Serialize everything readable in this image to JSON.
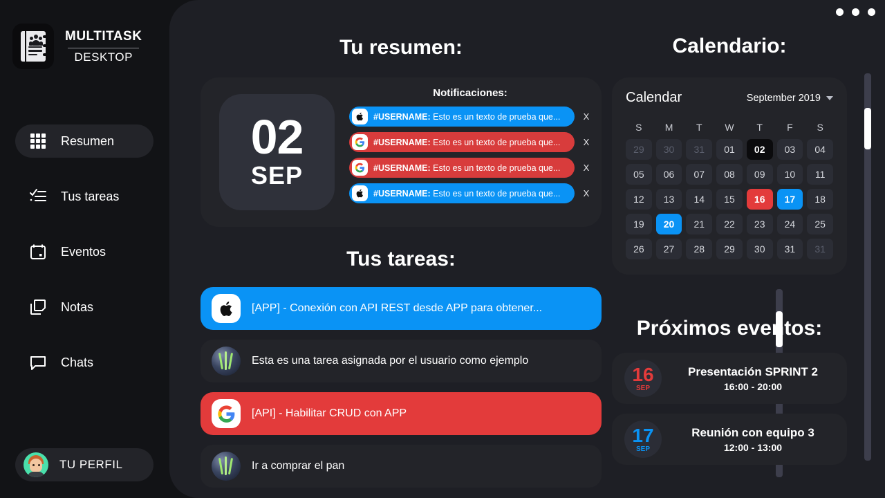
{
  "brand": {
    "title": "MULTITASK",
    "subtitle": "DESKTOP",
    "logo_icon": "contacts-book-icon"
  },
  "sidebar": {
    "items": [
      {
        "label": "Resumen",
        "icon": "grid-icon",
        "active": true
      },
      {
        "label": "Tus tareas",
        "icon": "checklist-icon",
        "active": false
      },
      {
        "label": "Eventos",
        "icon": "calendar-icon",
        "active": false
      },
      {
        "label": "Notas",
        "icon": "notes-icon",
        "active": false
      },
      {
        "label": "Chats",
        "icon": "chat-icon",
        "active": false
      }
    ],
    "profile": {
      "label": "TU PERFIL",
      "avatar_icon": "user-avatar"
    }
  },
  "window": {
    "dots": [
      "window-dot-1",
      "window-dot-2",
      "window-dot-3"
    ]
  },
  "summary": {
    "heading": "Tu resumen:",
    "date": {
      "day": "02",
      "month": "SEP"
    },
    "notifications_title": "Notificaciones:",
    "notifications": [
      {
        "provider": "apple-icon",
        "color": "blue",
        "user": "#USERNAME:",
        "text": "Esto es un texto de prueba que...",
        "close": "X"
      },
      {
        "provider": "google-icon",
        "color": "red",
        "user": "#USERNAME:",
        "text": "Esto es un texto de prueba que...",
        "close": "X"
      },
      {
        "provider": "google-icon",
        "color": "red",
        "user": "#USERNAME:",
        "text": "Esto es un texto de prueba que...",
        "close": "X"
      },
      {
        "provider": "apple-icon",
        "color": "blue",
        "user": "#USERNAME:",
        "text": "Esto es un texto de prueba que...",
        "close": "X"
      }
    ]
  },
  "tasks": {
    "heading": "Tus tareas:",
    "items": [
      {
        "badge": "apple-icon",
        "color": "blue",
        "text": "[APP] - Conexión con API REST desde APP para obtener..."
      },
      {
        "badge": "user-photo",
        "color": "neutral",
        "text": "Esta es una tarea asignada por el usuario como ejemplo"
      },
      {
        "badge": "google-icon",
        "color": "red",
        "text": "[API] - Habilitar CRUD con APP"
      },
      {
        "badge": "user-photo",
        "color": "neutral",
        "text": "Ir a comprar el pan"
      }
    ]
  },
  "calendar": {
    "heading": "Calendario:",
    "card_title": "Calendar",
    "month_label": "September 2019",
    "dow": [
      "S",
      "M",
      "T",
      "W",
      "T",
      "F",
      "S"
    ],
    "days": [
      {
        "n": "29",
        "state": "muted"
      },
      {
        "n": "30",
        "state": "muted"
      },
      {
        "n": "31",
        "state": "muted"
      },
      {
        "n": "01",
        "state": "normal"
      },
      {
        "n": "02",
        "state": "today"
      },
      {
        "n": "03",
        "state": "normal"
      },
      {
        "n": "04",
        "state": "normal"
      },
      {
        "n": "05",
        "state": "normal"
      },
      {
        "n": "06",
        "state": "normal"
      },
      {
        "n": "07",
        "state": "normal"
      },
      {
        "n": "08",
        "state": "normal"
      },
      {
        "n": "09",
        "state": "normal"
      },
      {
        "n": "10",
        "state": "normal"
      },
      {
        "n": "11",
        "state": "normal"
      },
      {
        "n": "12",
        "state": "normal"
      },
      {
        "n": "13",
        "state": "normal"
      },
      {
        "n": "14",
        "state": "normal"
      },
      {
        "n": "15",
        "state": "normal"
      },
      {
        "n": "16",
        "state": "red"
      },
      {
        "n": "17",
        "state": "blue"
      },
      {
        "n": "18",
        "state": "normal"
      },
      {
        "n": "19",
        "state": "normal"
      },
      {
        "n": "20",
        "state": "blue"
      },
      {
        "n": "21",
        "state": "normal"
      },
      {
        "n": "22",
        "state": "normal"
      },
      {
        "n": "23",
        "state": "normal"
      },
      {
        "n": "24",
        "state": "normal"
      },
      {
        "n": "25",
        "state": "normal"
      },
      {
        "n": "26",
        "state": "normal"
      },
      {
        "n": "27",
        "state": "normal"
      },
      {
        "n": "28",
        "state": "normal"
      },
      {
        "n": "29",
        "state": "normal"
      },
      {
        "n": "30",
        "state": "normal"
      },
      {
        "n": "31",
        "state": "normal"
      },
      {
        "n": "31",
        "state": "muted"
      }
    ]
  },
  "events": {
    "heading": "Próximos eventos:",
    "items": [
      {
        "day": "16",
        "month": "SEP",
        "color": "red",
        "name": "Presentación SPRINT 2",
        "time": "16:00 - 20:00"
      },
      {
        "day": "17",
        "month": "SEP",
        "color": "blue",
        "name": "Reunión con equipo 3",
        "time": "12:00 - 13:00"
      }
    ]
  },
  "colors": {
    "blue": "#0a93f5",
    "red": "#e33b3b",
    "panel": "#232429",
    "background": "#121316",
    "window": "#1e1f25"
  }
}
